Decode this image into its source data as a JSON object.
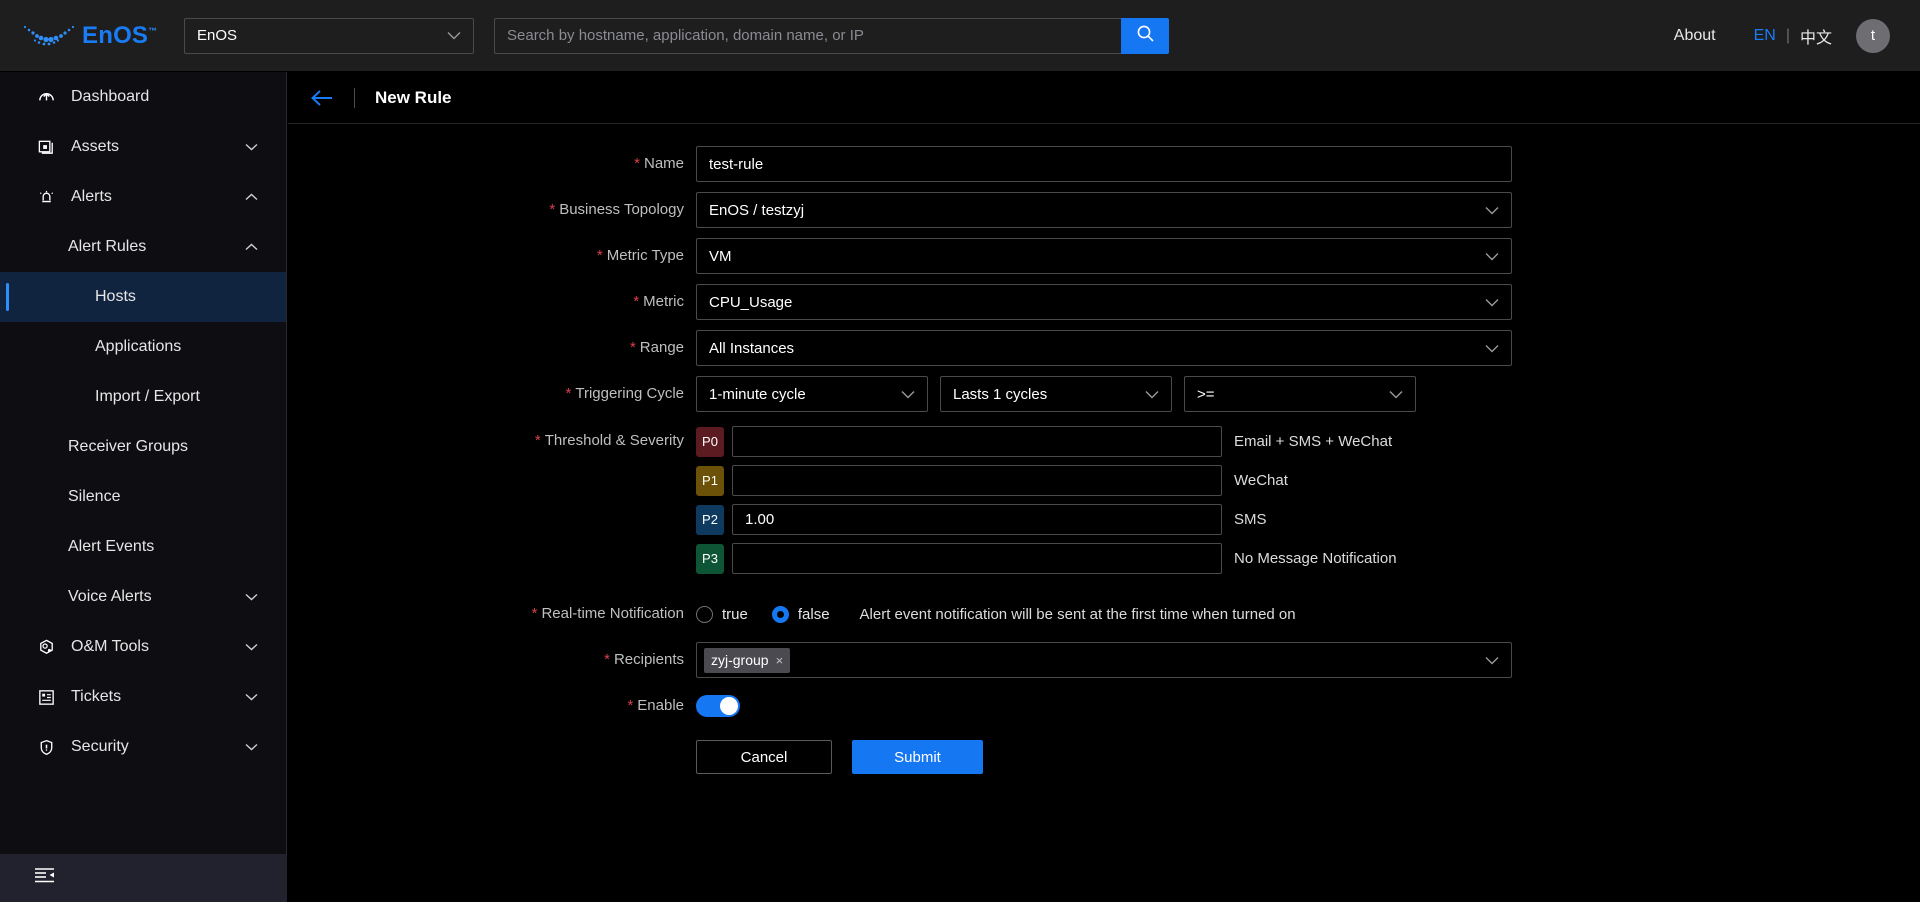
{
  "header": {
    "brand_name": "EnOS",
    "brand_tm": "™",
    "tenant": "EnOS",
    "search_placeholder": "Search by hostname, application, domain name, or IP",
    "search_value": "",
    "about": "About",
    "lang_en": "EN",
    "lang_divider": "|",
    "lang_zh": "中文",
    "avatar_initial": "t"
  },
  "sidebar": {
    "items": [
      {
        "label": "Dashboard",
        "icon": "dashboard-icon",
        "level": 0,
        "arrow": "",
        "active": false
      },
      {
        "label": "Assets",
        "icon": "assets-icon",
        "level": 0,
        "arrow": "⌄",
        "active": false
      },
      {
        "label": "Alerts",
        "icon": "alerts-icon",
        "level": 0,
        "arrow": "⌃",
        "active": false
      },
      {
        "label": "Alert Rules",
        "icon": "",
        "level": 1,
        "arrow": "⌃",
        "active": false
      },
      {
        "label": "Hosts",
        "icon": "",
        "level": 2,
        "arrow": "",
        "active": true
      },
      {
        "label": "Applications",
        "icon": "",
        "level": 2,
        "arrow": "",
        "active": false
      },
      {
        "label": "Import / Export",
        "icon": "",
        "level": 2,
        "arrow": "",
        "active": false
      },
      {
        "label": "Receiver Groups",
        "icon": "",
        "level": 1,
        "arrow": "",
        "active": false
      },
      {
        "label": "Silence",
        "icon": "",
        "level": 1,
        "arrow": "",
        "active": false
      },
      {
        "label": "Alert Events",
        "icon": "",
        "level": 1,
        "arrow": "",
        "active": false
      },
      {
        "label": "Voice Alerts",
        "icon": "",
        "level": 1,
        "arrow": "⌄",
        "active": false
      },
      {
        "label": "O&M Tools",
        "icon": "tools-icon",
        "level": 0,
        "arrow": "⌄",
        "active": false
      },
      {
        "label": "Tickets",
        "icon": "tickets-icon",
        "level": 0,
        "arrow": "⌄",
        "active": false
      },
      {
        "label": "Security",
        "icon": "shield-icon",
        "level": 0,
        "arrow": "⌄",
        "active": false
      }
    ],
    "collapse_icon": "collapse-sidebar-icon"
  },
  "page": {
    "title": "New Rule",
    "back_icon": "←"
  },
  "form": {
    "name": {
      "label": "Name",
      "required": true,
      "value": "test-rule"
    },
    "business_topology": {
      "label": "Business Topology",
      "required": true,
      "value": "EnOS / testzyj"
    },
    "metric_type": {
      "label": "Metric Type",
      "required": true,
      "value": "VM"
    },
    "metric": {
      "label": "Metric",
      "required": true,
      "value": "CPU_Usage"
    },
    "range": {
      "label": "Range",
      "required": true,
      "value": "All Instances"
    },
    "triggering_cycle": {
      "label": "Triggering Cycle",
      "required": true,
      "cycle": "1-minute cycle",
      "lasts": "Lasts 1 cycles",
      "operator": ">="
    },
    "threshold": {
      "label": "Threshold & Severity",
      "required": true,
      "rows": [
        {
          "severity": "P0",
          "value": "",
          "note": "Email + SMS + WeChat",
          "color": "#5c1a21"
        },
        {
          "severity": "P1",
          "value": "",
          "note": "WeChat",
          "color": "#6b5208"
        },
        {
          "severity": "P2",
          "value": "1.00",
          "note": "SMS",
          "color": "#0f3a5f"
        },
        {
          "severity": "P3",
          "value": "",
          "note": "No Message Notification",
          "color": "#0d5535"
        }
      ]
    },
    "realtime": {
      "label": "Real-time Notification",
      "required": true,
      "option_true": "true",
      "option_false": "false",
      "selected": "false",
      "hint": "Alert event notification will be sent at the first time when turned on"
    },
    "recipients": {
      "label": "Recipients",
      "required": true,
      "tags": [
        "zyj-group"
      ],
      "tag_remove": "×"
    },
    "enable": {
      "label": "Enable",
      "required": true,
      "on": true
    },
    "buttons": {
      "cancel": "Cancel",
      "submit": "Submit"
    }
  },
  "colors": {
    "accent": "#1677f2",
    "required_star": "#d9404a",
    "active_nav_bg": "#10233f",
    "active_nav_bar": "#2f8ef7"
  }
}
